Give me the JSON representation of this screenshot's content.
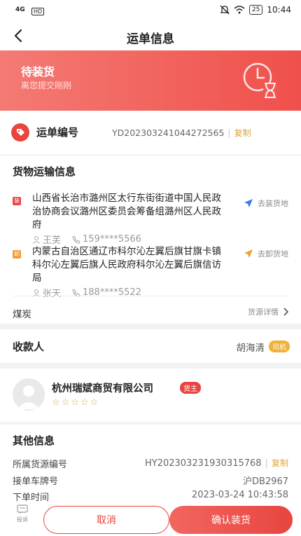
{
  "status_bar": {
    "signal": "4G",
    "network_badge": "HD",
    "battery": "25",
    "time": "10:44"
  },
  "header": {
    "title": "运单信息"
  },
  "banner": {
    "status": "待装货",
    "subtitle": "离您提交刚刚",
    "icon": "clock-hourglass-icon"
  },
  "order": {
    "label": "运单编号",
    "number": "YD202303241044272565",
    "separator": "|",
    "copy_label": "复制"
  },
  "cargo": {
    "title": "货物运输信息",
    "loading": {
      "tag": "装",
      "address": "山西省长治市潞州区太行东街街道中国人民政治协商会议潞州区委员会筹备组潞州区人民政府",
      "contact_name": "王芙",
      "contact_phone": "159****5566",
      "nav_label": "去装货地"
    },
    "unloading": {
      "tag": "卸",
      "address": "内蒙古自治区通辽市科尔沁左翼后旗甘旗卡镇科尔沁左翼后旗人民政府科尔沁左翼后旗信访局",
      "contact_name": "张天",
      "contact_phone": "188****5522",
      "nav_label": "去卸货地"
    },
    "goods_name": "煤炭",
    "goods_detail_label": "货源详情"
  },
  "payee": {
    "label": "收款人",
    "name": "胡海清",
    "badge": "司机"
  },
  "shipper": {
    "name": "杭州瑞斌商贸有限公司",
    "badge": "货主",
    "stars": "☆☆☆☆☆"
  },
  "other": {
    "title": "其他信息",
    "source_label": "所属货源编号",
    "source_no": "HY202303231930315768",
    "separator": "|",
    "copy_label": "复制",
    "plate_label": "接单车牌号",
    "plate": "沪DB2967",
    "time_label": "下单时间",
    "time": "2023-03-24 10:43:58"
  },
  "bottom": {
    "report_label": "投诉",
    "cancel_label": "取消",
    "confirm_label": "确认装货"
  },
  "colors": {
    "primary": "#e8453f",
    "accent_gold": "#e1a43a",
    "banner_start": "#f47a74",
    "banner_end": "#f0504b"
  }
}
